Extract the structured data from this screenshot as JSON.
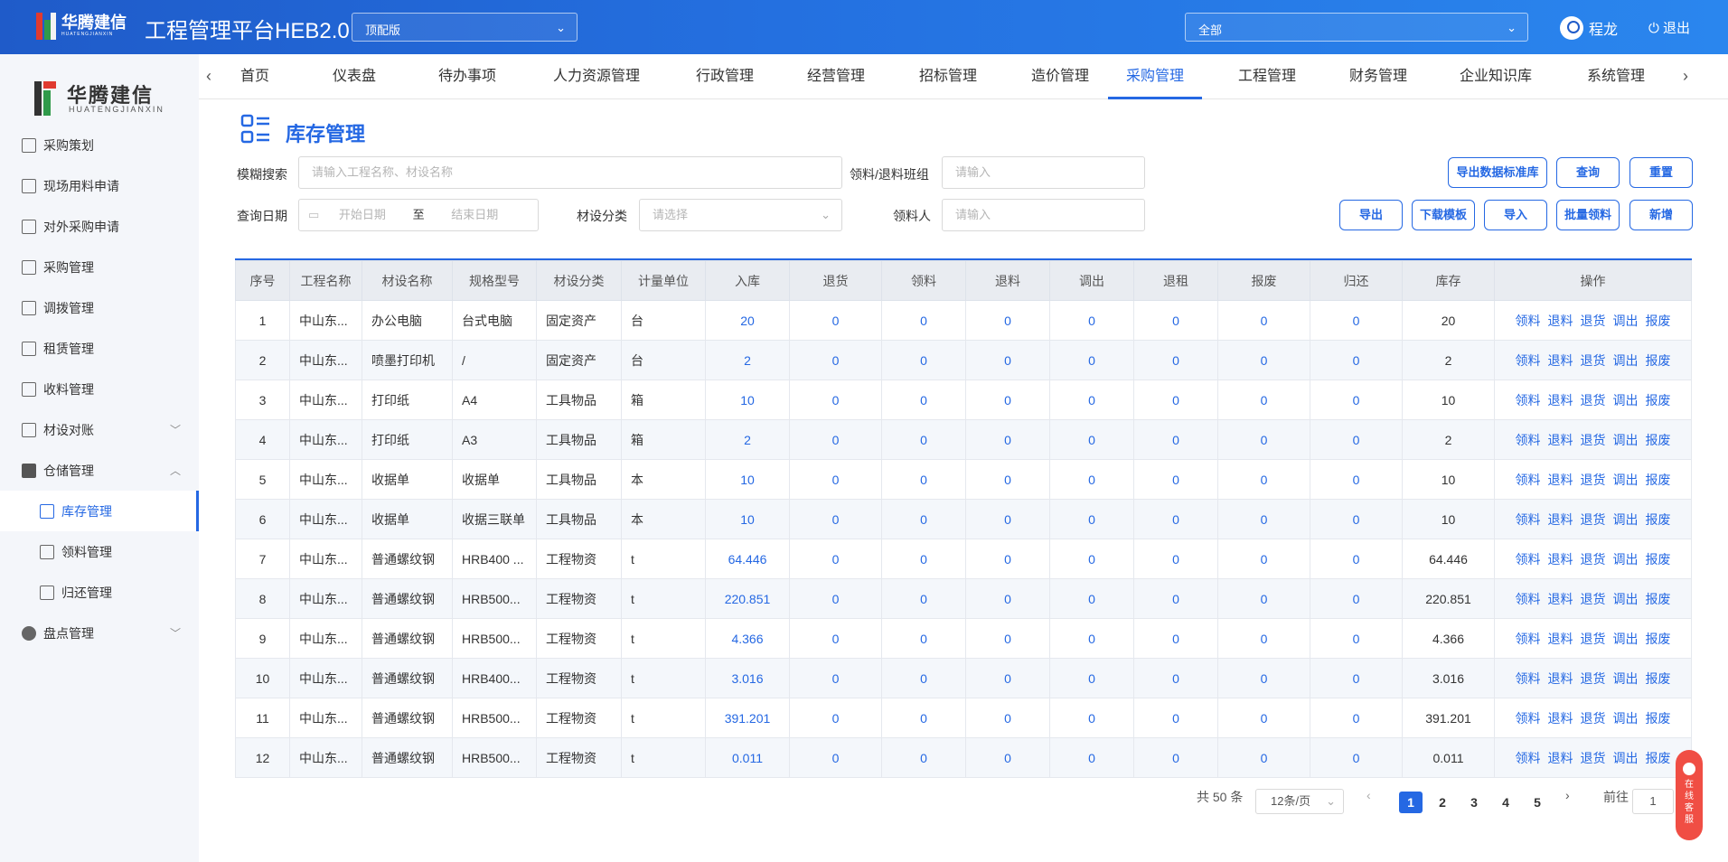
{
  "header": {
    "logo_text": "华腾建信",
    "logo_sub": "HUATENGJIANXIN",
    "title": "工程管理平台HEB2.0",
    "edition_select": "顶配版",
    "scope_select": "全部",
    "user_name": "程龙",
    "logout_label": "退出"
  },
  "sidebar": {
    "logo_text": "华腾建信",
    "logo_sub": "HUATENGJIANXIN",
    "items": [
      {
        "label": "采购策划"
      },
      {
        "label": "现场用料申请"
      },
      {
        "label": "对外采购申请"
      },
      {
        "label": "采购管理"
      },
      {
        "label": "调拨管理"
      },
      {
        "label": "租赁管理"
      },
      {
        "label": "收料管理"
      },
      {
        "label": "材设对账"
      },
      {
        "label": "仓储管理"
      },
      {
        "label": "库存管理"
      },
      {
        "label": "领料管理"
      },
      {
        "label": "归还管理"
      },
      {
        "label": "盘点管理"
      }
    ]
  },
  "nav": {
    "tabs": [
      "首页",
      "仪表盘",
      "待办事项",
      "人力资源管理",
      "行政管理",
      "经营管理",
      "招标管理",
      "造价管理",
      "采购管理",
      "工程管理",
      "财务管理",
      "企业知识库",
      "系统管理"
    ],
    "active": "采购管理"
  },
  "page": {
    "title": "库存管理"
  },
  "filters": {
    "fuzzy_label": "模糊搜索",
    "fuzzy_placeholder": "请输入工程名称、材设名称",
    "team_label": "领料/退料班组",
    "team_placeholder": "请输入",
    "date_label": "查询日期",
    "start_placeholder": "开始日期",
    "date_sep": "至",
    "end_placeholder": "结束日期",
    "category_label": "材设分类",
    "category_placeholder": "请选择",
    "receiver_label": "领料人",
    "receiver_placeholder": "请输入"
  },
  "buttons": {
    "export_std": "导出数据标准库",
    "query": "查询",
    "reset": "重置",
    "export": "导出",
    "download_tpl": "下载模板",
    "import": "导入",
    "batch_issue": "批量领料",
    "add": "新增"
  },
  "table": {
    "headers": [
      "序号",
      "工程名称",
      "材设名称",
      "规格型号",
      "材设分类",
      "计量单位",
      "入库",
      "退货",
      "领料",
      "退料",
      "调出",
      "退租",
      "报废",
      "归还",
      "库存",
      "操作"
    ],
    "ops": [
      "领料",
      "退料",
      "退货",
      "调出",
      "报废"
    ],
    "rows": [
      [
        "1",
        "中山东...",
        "办公电脑",
        "台式电脑",
        "固定资产",
        "台",
        "20",
        "0",
        "0",
        "0",
        "0",
        "0",
        "0",
        "0",
        "20"
      ],
      [
        "2",
        "中山东...",
        "喷墨打印机",
        "/",
        "固定资产",
        "台",
        "2",
        "0",
        "0",
        "0",
        "0",
        "0",
        "0",
        "0",
        "2"
      ],
      [
        "3",
        "中山东...",
        "打印纸",
        "A4",
        "工具物品",
        "箱",
        "10",
        "0",
        "0",
        "0",
        "0",
        "0",
        "0",
        "0",
        "10"
      ],
      [
        "4",
        "中山东...",
        "打印纸",
        "A3",
        "工具物品",
        "箱",
        "2",
        "0",
        "0",
        "0",
        "0",
        "0",
        "0",
        "0",
        "2"
      ],
      [
        "5",
        "中山东...",
        "收据单",
        "收据单",
        "工具物品",
        "本",
        "10",
        "0",
        "0",
        "0",
        "0",
        "0",
        "0",
        "0",
        "10"
      ],
      [
        "6",
        "中山东...",
        "收据单",
        "收据三联单",
        "工具物品",
        "本",
        "10",
        "0",
        "0",
        "0",
        "0",
        "0",
        "0",
        "0",
        "10"
      ],
      [
        "7",
        "中山东...",
        "普通螺纹钢",
        "HRB400 ...",
        "工程物资",
        "t",
        "64.446",
        "0",
        "0",
        "0",
        "0",
        "0",
        "0",
        "0",
        "64.446"
      ],
      [
        "8",
        "中山东...",
        "普通螺纹钢",
        "HRB500...",
        "工程物资",
        "t",
        "220.851",
        "0",
        "0",
        "0",
        "0",
        "0",
        "0",
        "0",
        "220.851"
      ],
      [
        "9",
        "中山东...",
        "普通螺纹钢",
        "HRB500...",
        "工程物资",
        "t",
        "4.366",
        "0",
        "0",
        "0",
        "0",
        "0",
        "0",
        "0",
        "4.366"
      ],
      [
        "10",
        "中山东...",
        "普通螺纹钢",
        "HRB400...",
        "工程物资",
        "t",
        "3.016",
        "0",
        "0",
        "0",
        "0",
        "0",
        "0",
        "0",
        "3.016"
      ],
      [
        "11",
        "中山东...",
        "普通螺纹钢",
        "HRB500...",
        "工程物资",
        "t",
        "391.201",
        "0",
        "0",
        "0",
        "0",
        "0",
        "0",
        "0",
        "391.201"
      ],
      [
        "12",
        "中山东...",
        "普通螺纹钢",
        "HRB500...",
        "工程物资",
        "t",
        "0.011",
        "0",
        "0",
        "0",
        "0",
        "0",
        "0",
        "0",
        "0.011"
      ]
    ]
  },
  "pagination": {
    "total": "共 50 条",
    "page_size": "12条/页",
    "pages": [
      "1",
      "2",
      "3",
      "4",
      "5"
    ],
    "current": "1",
    "goto_label": "前往",
    "goto_value": "1"
  },
  "float_service": {
    "label": "在线客服"
  },
  "colors": {
    "accent": "#2568e3",
    "header_start": "#1f5bc9",
    "header_end": "#2a86ee",
    "service_badge": "#f04e44"
  }
}
